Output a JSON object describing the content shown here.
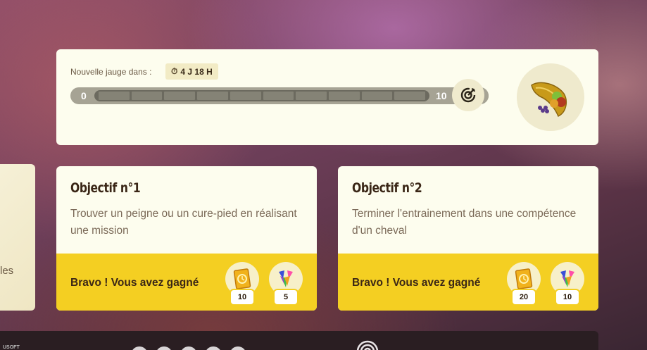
{
  "gauge": {
    "timer_label": "Nouvelle jauge dans :",
    "timer_value": "4 J 18 H",
    "min": "0",
    "max": "10",
    "progress": 0
  },
  "left_card": {
    "text_fragment": "les"
  },
  "objectives": [
    {
      "title": "Objectif n°1",
      "description": "Trouver un peigne ou un cure-pied en réalisant une mission",
      "reward_label": "Bravo ! Vous avez gagné",
      "rewards": [
        {
          "icon": "passes-icon",
          "count": "10"
        },
        {
          "icon": "gems-icon",
          "count": "5"
        }
      ]
    },
    {
      "title": "Objectif n°2",
      "description": "Terminer l'entrainement dans une compétence d'un cheval",
      "reward_label": "Bravo ! Vous avez gagné",
      "rewards": [
        {
          "icon": "passes-icon",
          "count": "20"
        },
        {
          "icon": "gems-icon",
          "count": "10"
        }
      ]
    }
  ],
  "footer": {
    "brand_fragment": "USOFT"
  },
  "colors": {
    "card_bg": "#fdfdee",
    "reward_bar": "#f4cf22",
    "title_text": "#3a2616",
    "body_text": "#7b6a58"
  }
}
